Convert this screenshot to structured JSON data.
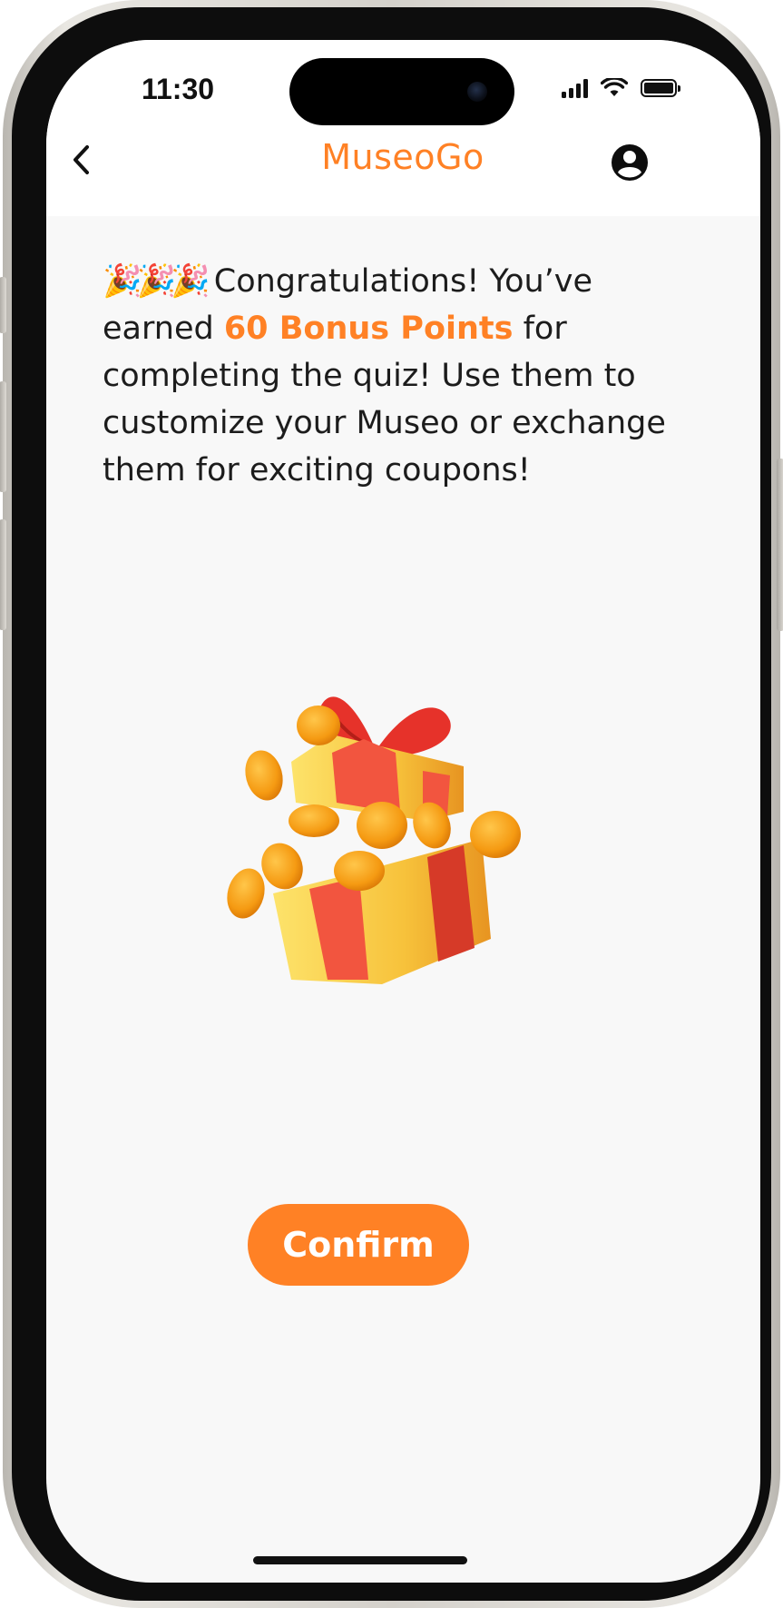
{
  "status_bar": {
    "time": "11:30",
    "icons": [
      "cellular-signal-icon",
      "wifi-icon",
      "battery-icon"
    ]
  },
  "header": {
    "back_icon": "chevron-left-icon",
    "title": "MuseoGo",
    "profile_icon": "user-circle-icon"
  },
  "message": {
    "emoji": "🎉🎉🎉",
    "text_before": "Congratulations! You’ve earned ",
    "highlight": "60 Bonus Points",
    "text_after": " for completing the quiz! Use them to customize your Museo or exchange them for exciting coupons!"
  },
  "illustration": {
    "icon": "gift-box-with-coins-icon"
  },
  "confirm_button": {
    "label": "Confirm"
  },
  "colors": {
    "accent": "#ff8125",
    "background": "#f8f8f8",
    "header_background": "#ffffff",
    "text": "#1c1c1c"
  }
}
